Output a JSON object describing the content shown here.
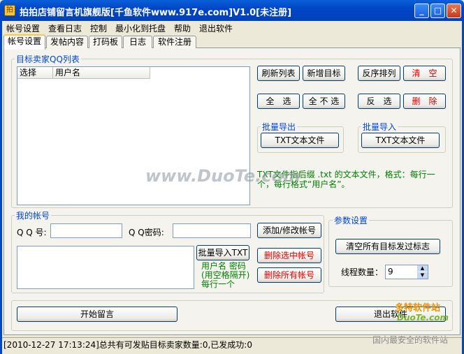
{
  "window": {
    "title": "拍拍店铺留言机旗舰版[千鱼软件www.917e.com]V1.0[未注册]",
    "app_icon": "拍"
  },
  "menu": [
    "帐号设置",
    "查看日志",
    "控制",
    "最小化到托盘",
    "帮助",
    "退出软件"
  ],
  "tabs": [
    "帐号设置",
    "发帖内容",
    "打码板",
    "日志",
    "软件注册"
  ],
  "target_group": {
    "label": "目标卖家QQ列表",
    "columns": [
      "选择",
      "用户名"
    ],
    "buttons": {
      "refresh": "刷新列表",
      "add": "新增目标",
      "reverse_sort": "反序排列",
      "clear": "清　空",
      "select_all": "全　选",
      "select_none": "全 不 选",
      "invert": "反　选",
      "delete": "删　除"
    },
    "export_label": "批量导出",
    "export_btn": "TXT文本文件",
    "import_label": "批量导入",
    "import_btn": "TXT文本文件",
    "note": "TXT文件指后缀 .txt 的文本文件，格式：每行一个，每行格式“用户名”。"
  },
  "account_group": {
    "label": "我的帐号",
    "qq_label": "Q Q 号:",
    "qq_value": "",
    "pwd_label": "Q Q密码:",
    "pwd_value": "",
    "add_edit_btn": "添加/修改帐号",
    "import_btn": "批量导入TXT",
    "import_hint_1": "用户名 密码",
    "import_hint_2": "(用空格隔开)",
    "import_hint_3": "每行一个",
    "delete_selected_btn": "删除选中帐号",
    "delete_all_btn": "删除所有帐号"
  },
  "params_group": {
    "label": "参数设置",
    "clear_flags_btn": "清空所有目标发过标志",
    "threads_label": "线程数量：",
    "threads_value": "9"
  },
  "footer": {
    "start_btn": "开始留言",
    "exit_btn": "退出软件"
  },
  "status": "[2010-12-27 17:13:24]总共有可发贴目标卖家数量:0,已发成功:0",
  "watermark": {
    "text": "www.DuoTe.com",
    "corner_1": "多特软件站",
    "corner_2": "DuoTe.com",
    "corner_3": "国内最安全的软件站"
  }
}
